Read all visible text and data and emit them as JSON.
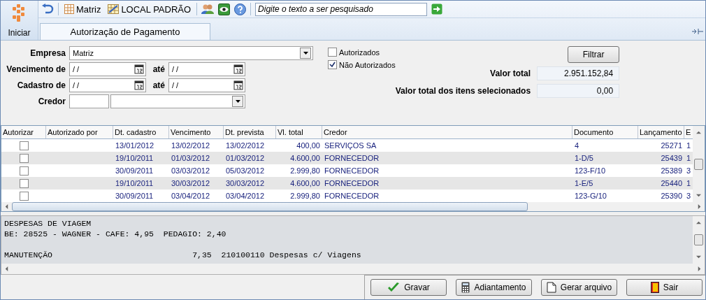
{
  "toolbar": {
    "start_label": "Iniciar",
    "company": "Matriz",
    "location": "LOCAL PADRÃO",
    "search": {
      "placeholder": "Digite o texto a ser pesquisado"
    }
  },
  "tabs": [
    {
      "label": "Autorização de Pagamento",
      "selected": true
    }
  ],
  "filters": {
    "company_label": "Empresa",
    "company_value": "Matriz",
    "due_label": "Vencimento de",
    "due_from": "/ /",
    "due_to_label": "até",
    "due_to": "/ /",
    "reg_label": "Cadastro de",
    "reg_from": "/ /",
    "reg_to_label": "até",
    "reg_to": "/ /",
    "creditor_label": "Credor",
    "checks": [
      {
        "label": "Autorizados",
        "checked": false
      },
      {
        "label": "Não Autorizados",
        "checked": true
      }
    ],
    "filter_button": "Filtrar",
    "total_label": "Valor total",
    "total_value": "2.951.152,84",
    "selected_total_label": "Valor total dos itens selecionados",
    "selected_total_value": "0,00"
  },
  "table": {
    "columns": [
      "Autorizar",
      "Autorizado por",
      "Dt. cadastro",
      "Vencimento",
      "Dt. prevista",
      "Vl. total",
      "Credor",
      "Documento",
      "Lançamento",
      "E"
    ],
    "rows": [
      {
        "checked": false,
        "cells": [
          "",
          "",
          "13/01/2012",
          "13/02/2012",
          "13/02/2012",
          "400,00",
          "SERVIÇOS SA",
          "4",
          "25271",
          "1"
        ]
      },
      {
        "checked": false,
        "cells": [
          "",
          "",
          "19/10/2011",
          "01/03/2012",
          "01/03/2012",
          "4.600,00",
          "FORNECEDOR",
          "1-D/5",
          "25439",
          "1"
        ]
      },
      {
        "checked": false,
        "cells": [
          "",
          "",
          "30/09/2011",
          "03/03/2012",
          "05/03/2012",
          "2.999,80",
          "FORNECEDOR",
          "123-F/10",
          "25389",
          "3"
        ]
      },
      {
        "checked": false,
        "cells": [
          "",
          "",
          "19/10/2011",
          "30/03/2012",
          "30/03/2012",
          "4.600,00",
          "FORNECEDOR",
          "1-E/5",
          "25440",
          "1"
        ]
      },
      {
        "checked": false,
        "cells": [
          "",
          "",
          "30/09/2011",
          "03/04/2012",
          "03/04/2012",
          "2.999,80",
          "FORNECEDOR",
          "123-G/10",
          "25390",
          "3"
        ]
      }
    ]
  },
  "memo": [
    [
      "DESPESAS DE VIAGEM",
      "BE: 28525 - WAGNER - CAFE: 4,95  PEDAGIO: 2,40"
    ],
    [
      "MANUTENÇÃO                             7,35  210100110 Despesas c/ Viagens"
    ]
  ],
  "buttons": [
    {
      "kind": "save",
      "label": "Gravar"
    },
    {
      "kind": "advance",
      "label": "Adiantamento"
    },
    {
      "kind": "file",
      "label": "Gerar arquivo"
    },
    {
      "kind": "exit",
      "label": "Sair"
    }
  ]
}
